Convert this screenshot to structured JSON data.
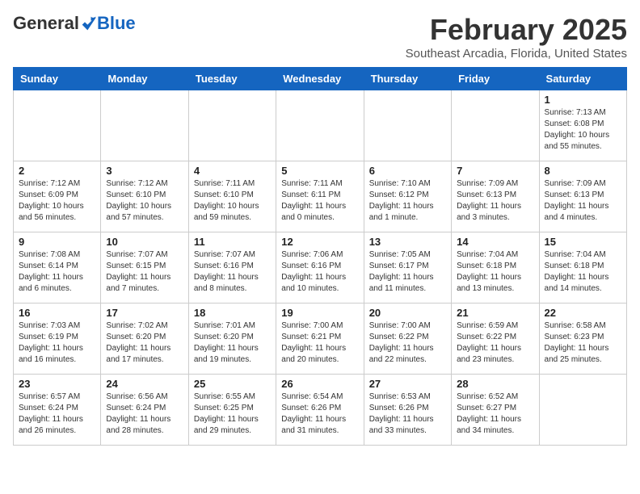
{
  "header": {
    "logo_general": "General",
    "logo_blue": "Blue",
    "month": "February 2025",
    "location": "Southeast Arcadia, Florida, United States"
  },
  "weekdays": [
    "Sunday",
    "Monday",
    "Tuesday",
    "Wednesday",
    "Thursday",
    "Friday",
    "Saturday"
  ],
  "weeks": [
    [
      {
        "day": "",
        "info": ""
      },
      {
        "day": "",
        "info": ""
      },
      {
        "day": "",
        "info": ""
      },
      {
        "day": "",
        "info": ""
      },
      {
        "day": "",
        "info": ""
      },
      {
        "day": "",
        "info": ""
      },
      {
        "day": "1",
        "info": "Sunrise: 7:13 AM\nSunset: 6:08 PM\nDaylight: 10 hours\nand 55 minutes."
      }
    ],
    [
      {
        "day": "2",
        "info": "Sunrise: 7:12 AM\nSunset: 6:09 PM\nDaylight: 10 hours\nand 56 minutes."
      },
      {
        "day": "3",
        "info": "Sunrise: 7:12 AM\nSunset: 6:10 PM\nDaylight: 10 hours\nand 57 minutes."
      },
      {
        "day": "4",
        "info": "Sunrise: 7:11 AM\nSunset: 6:10 PM\nDaylight: 10 hours\nand 59 minutes."
      },
      {
        "day": "5",
        "info": "Sunrise: 7:11 AM\nSunset: 6:11 PM\nDaylight: 11 hours\nand 0 minutes."
      },
      {
        "day": "6",
        "info": "Sunrise: 7:10 AM\nSunset: 6:12 PM\nDaylight: 11 hours\nand 1 minute."
      },
      {
        "day": "7",
        "info": "Sunrise: 7:09 AM\nSunset: 6:13 PM\nDaylight: 11 hours\nand 3 minutes."
      },
      {
        "day": "8",
        "info": "Sunrise: 7:09 AM\nSunset: 6:13 PM\nDaylight: 11 hours\nand 4 minutes."
      }
    ],
    [
      {
        "day": "9",
        "info": "Sunrise: 7:08 AM\nSunset: 6:14 PM\nDaylight: 11 hours\nand 6 minutes."
      },
      {
        "day": "10",
        "info": "Sunrise: 7:07 AM\nSunset: 6:15 PM\nDaylight: 11 hours\nand 7 minutes."
      },
      {
        "day": "11",
        "info": "Sunrise: 7:07 AM\nSunset: 6:16 PM\nDaylight: 11 hours\nand 8 minutes."
      },
      {
        "day": "12",
        "info": "Sunrise: 7:06 AM\nSunset: 6:16 PM\nDaylight: 11 hours\nand 10 minutes."
      },
      {
        "day": "13",
        "info": "Sunrise: 7:05 AM\nSunset: 6:17 PM\nDaylight: 11 hours\nand 11 minutes."
      },
      {
        "day": "14",
        "info": "Sunrise: 7:04 AM\nSunset: 6:18 PM\nDaylight: 11 hours\nand 13 minutes."
      },
      {
        "day": "15",
        "info": "Sunrise: 7:04 AM\nSunset: 6:18 PM\nDaylight: 11 hours\nand 14 minutes."
      }
    ],
    [
      {
        "day": "16",
        "info": "Sunrise: 7:03 AM\nSunset: 6:19 PM\nDaylight: 11 hours\nand 16 minutes."
      },
      {
        "day": "17",
        "info": "Sunrise: 7:02 AM\nSunset: 6:20 PM\nDaylight: 11 hours\nand 17 minutes."
      },
      {
        "day": "18",
        "info": "Sunrise: 7:01 AM\nSunset: 6:20 PM\nDaylight: 11 hours\nand 19 minutes."
      },
      {
        "day": "19",
        "info": "Sunrise: 7:00 AM\nSunset: 6:21 PM\nDaylight: 11 hours\nand 20 minutes."
      },
      {
        "day": "20",
        "info": "Sunrise: 7:00 AM\nSunset: 6:22 PM\nDaylight: 11 hours\nand 22 minutes."
      },
      {
        "day": "21",
        "info": "Sunrise: 6:59 AM\nSunset: 6:22 PM\nDaylight: 11 hours\nand 23 minutes."
      },
      {
        "day": "22",
        "info": "Sunrise: 6:58 AM\nSunset: 6:23 PM\nDaylight: 11 hours\nand 25 minutes."
      }
    ],
    [
      {
        "day": "23",
        "info": "Sunrise: 6:57 AM\nSunset: 6:24 PM\nDaylight: 11 hours\nand 26 minutes."
      },
      {
        "day": "24",
        "info": "Sunrise: 6:56 AM\nSunset: 6:24 PM\nDaylight: 11 hours\nand 28 minutes."
      },
      {
        "day": "25",
        "info": "Sunrise: 6:55 AM\nSunset: 6:25 PM\nDaylight: 11 hours\nand 29 minutes."
      },
      {
        "day": "26",
        "info": "Sunrise: 6:54 AM\nSunset: 6:26 PM\nDaylight: 11 hours\nand 31 minutes."
      },
      {
        "day": "27",
        "info": "Sunrise: 6:53 AM\nSunset: 6:26 PM\nDaylight: 11 hours\nand 33 minutes."
      },
      {
        "day": "28",
        "info": "Sunrise: 6:52 AM\nSunset: 6:27 PM\nDaylight: 11 hours\nand 34 minutes."
      },
      {
        "day": "",
        "info": ""
      }
    ]
  ]
}
